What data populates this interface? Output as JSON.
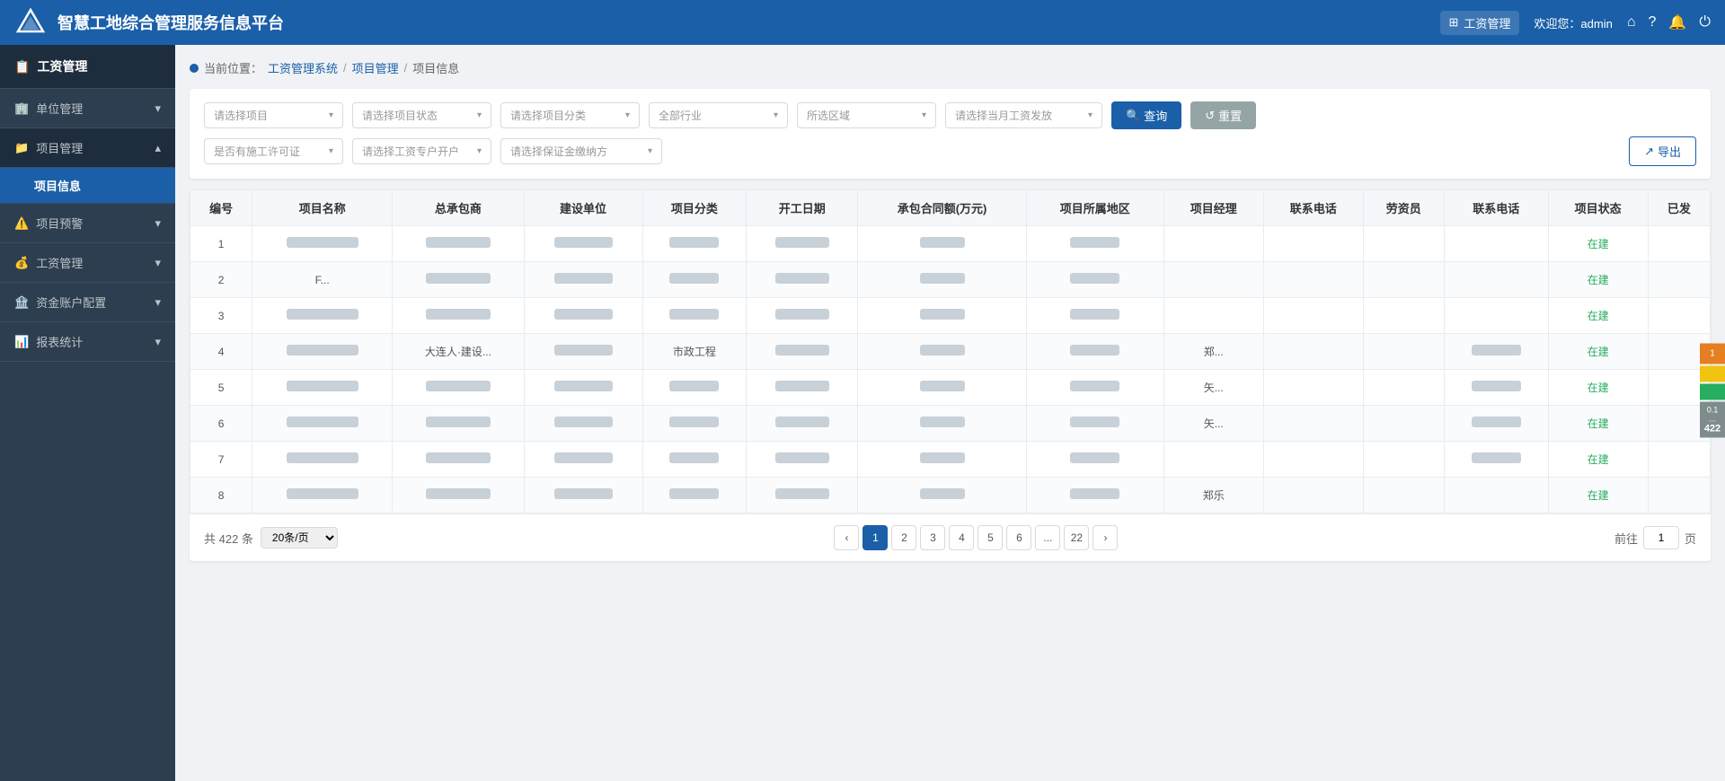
{
  "header": {
    "title": "智慧工地综合管理服务信息平台",
    "nav_label": "工资管理",
    "welcome": "欢迎您：admin"
  },
  "sidebar": {
    "header_label": "工资管理",
    "items": [
      {
        "id": "unit-mgmt",
        "label": "单位管理",
        "icon": "🏢",
        "expandable": true,
        "active": false
      },
      {
        "id": "project-mgmt",
        "label": "项目管理",
        "icon": "📁",
        "expandable": true,
        "active": true
      },
      {
        "id": "project-info",
        "label": "项目信息",
        "sub": true,
        "active": true
      },
      {
        "id": "project-warning",
        "label": "项目预警",
        "icon": "⚠️",
        "expandable": true,
        "active": false
      },
      {
        "id": "salary-mgmt",
        "label": "工资管理",
        "icon": "💰",
        "expandable": true,
        "active": false
      },
      {
        "id": "fund-account",
        "label": "资金账户配置",
        "icon": "🏦",
        "expandable": true,
        "active": false
      },
      {
        "id": "report-stats",
        "label": "报表统计",
        "icon": "📊",
        "expandable": true,
        "active": false
      }
    ]
  },
  "breadcrumb": {
    "current_label": "当前位置：",
    "parts": [
      "工资管理系统",
      "项目管理",
      "项目信息"
    ]
  },
  "filters": {
    "project_placeholder": "请选择项目",
    "status_placeholder": "请选择项目状态",
    "category_placeholder": "请选择项目分类",
    "industry_placeholder": "全部行业",
    "region_placeholder": "所选区域",
    "salary_month_placeholder": "请选择当月工资发放",
    "permit_placeholder": "是否有施工许可证",
    "account_placeholder": "请选择工资专户开户",
    "guarantee_placeholder": "请选择保证金缴纳方",
    "search_label": "查询",
    "reset_label": "重置",
    "export_label": "导出"
  },
  "table": {
    "columns": [
      "编号",
      "项目名称",
      "总承包商",
      "建设单位",
      "项目分类",
      "开工日期",
      "承包合同额(万元)",
      "项目所属地区",
      "项目经理",
      "联系电话",
      "劳资员",
      "联系电话",
      "项目状态",
      "已发"
    ],
    "rows": [
      {
        "id": 1,
        "name": "",
        "contractor": "",
        "builder": "",
        "category": "",
        "start_date": "",
        "amount": "",
        "region": "",
        "manager": "",
        "phone": "",
        "labor": "",
        "labor_phone": "",
        "status": "在建",
        "issued": ""
      },
      {
        "id": 2,
        "name": "F...",
        "contractor": "",
        "builder": "",
        "category": "",
        "start_date": "",
        "amount": "",
        "region": "",
        "manager": "",
        "phone": "",
        "labor": "",
        "labor_phone": "",
        "status": "在建",
        "issued": ""
      },
      {
        "id": 3,
        "name": "",
        "contractor": "",
        "builder": "",
        "category": "",
        "start_date": "",
        "amount": "",
        "region": "",
        "manager": "",
        "phone": "",
        "labor": "",
        "labor_phone": "",
        "status": "在建",
        "issued": ""
      },
      {
        "id": 4,
        "name": "",
        "contractor": "大连人·建设...",
        "builder": "",
        "category": "市政工程",
        "start_date": "",
        "amount": "",
        "region": "",
        "manager": "郑...",
        "phone": "",
        "labor": "",
        "labor_phone": "",
        "status": "在建",
        "issued": ""
      },
      {
        "id": 5,
        "name": "",
        "contractor": "",
        "builder": "",
        "category": "",
        "start_date": "",
        "amount": "",
        "region": "",
        "manager": "矢...",
        "phone": "",
        "labor": "",
        "labor_phone": "",
        "status": "在建",
        "issued": ""
      },
      {
        "id": 6,
        "name": "",
        "contractor": "",
        "builder": "",
        "category": "",
        "start_date": "",
        "amount": "",
        "region": "",
        "manager": "矢...",
        "phone": "",
        "labor": "",
        "labor_phone": "",
        "status": "在建",
        "issued": ""
      },
      {
        "id": 7,
        "name": "",
        "contractor": "",
        "builder": "",
        "category": "",
        "start_date": "",
        "amount": "",
        "region": "",
        "manager": "",
        "phone": "",
        "labor": "",
        "labor_phone": "",
        "status": "在建",
        "issued": ""
      },
      {
        "id": 8,
        "name": "",
        "contractor": "",
        "builder": "",
        "category": "",
        "start_date": "",
        "amount": "",
        "region": "",
        "manager": "郑乐",
        "phone": "",
        "labor": "",
        "labor_phone": "",
        "status": "在建",
        "issued": ""
      }
    ]
  },
  "pagination": {
    "total_label": "共 422 条",
    "page_size_label": "20条/页",
    "pages": [
      "1",
      "2",
      "3",
      "4",
      "5",
      "6",
      "...",
      "22"
    ],
    "current_page": 1,
    "prev_label": "‹",
    "next_label": "›",
    "goto_prefix": "前往",
    "goto_value": "1",
    "goto_suffix": "页"
  },
  "notifications": {
    "count_label": "422",
    "items": [
      "1",
      ""
    ]
  }
}
